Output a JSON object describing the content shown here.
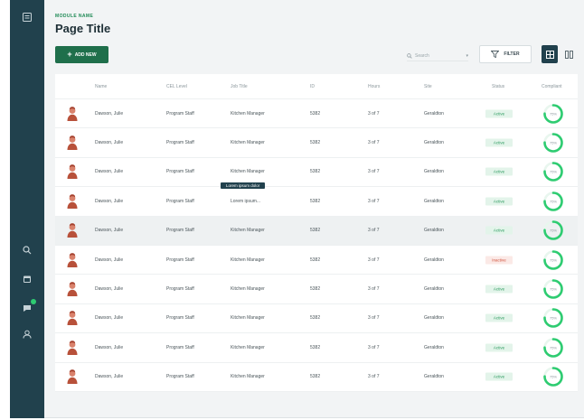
{
  "header": {
    "module_name": "MODULE NAME",
    "page_title": "Page Title"
  },
  "toolbar": {
    "add_label": "ADD NEW",
    "search_placeholder": "Search",
    "filter_label": "FILTER"
  },
  "table": {
    "columns": [
      "Name",
      "CEL Level",
      "Job Title",
      "ID",
      "Hours",
      "Site",
      "Status",
      "Compliant"
    ],
    "rows": [
      {
        "name": "Dawson, Julie",
        "level": "Program Staff",
        "job": "Kitchen Manager",
        "id": "5382",
        "hours": "3 of 7",
        "site": "Geraldton",
        "status": "Active",
        "compliant": "75%"
      },
      {
        "name": "Dawson, Julie",
        "level": "Program Staff",
        "job": "Kitchen Manager",
        "id": "5382",
        "hours": "3 of 7",
        "site": "Geraldton",
        "status": "Active",
        "compliant": "75%"
      },
      {
        "name": "Dawson, Julie",
        "level": "Program Staff",
        "job": "Kitchen Manager",
        "id": "5382",
        "hours": "3 of 7",
        "site": "Geraldton",
        "status": "Active",
        "compliant": "75%"
      },
      {
        "name": "Dawson, Julie",
        "level": "Program Staff",
        "job": "Lorem ipsum...",
        "id": "5382",
        "hours": "3 of 7",
        "site": "Geraldton",
        "status": "Active",
        "compliant": "75%",
        "tooltip": "Lorem ipsum dolor"
      },
      {
        "name": "Dawson, Julie",
        "level": "Program Staff",
        "job": "Kitchen Manager",
        "id": "5382",
        "hours": "3 of 7",
        "site": "Geraldton",
        "status": "Active",
        "compliant": "75%"
      },
      {
        "name": "Dawson, Julie",
        "level": "Program Staff",
        "job": "Kitchen Manager",
        "id": "5382",
        "hours": "3 of 7",
        "site": "Geraldton",
        "status": "Inactive",
        "compliant": "75%"
      },
      {
        "name": "Dawson, Julie",
        "level": "Program Staff",
        "job": "Kitchen Manager",
        "id": "5382",
        "hours": "3 of 7",
        "site": "Geraldton",
        "status": "Active",
        "compliant": "75%"
      },
      {
        "name": "Dawson, Julie",
        "level": "Program Staff",
        "job": "Kitchen Manager",
        "id": "5382",
        "hours": "3 of 7",
        "site": "Geraldton",
        "status": "Active",
        "compliant": "75%"
      },
      {
        "name": "Dawson, Julie",
        "level": "Program Staff",
        "job": "Kitchen Manager",
        "id": "5382",
        "hours": "3 of 7",
        "site": "Geraldton",
        "status": "Active",
        "compliant": "75%"
      },
      {
        "name": "Dawson, Julie",
        "level": "Program Staff",
        "job": "Kitchen Manager",
        "id": "5382",
        "hours": "3 of 7",
        "site": "Geraldton",
        "status": "Active",
        "compliant": "75%"
      }
    ]
  },
  "sidebar": {
    "icons": [
      "menu-icon",
      "search-icon",
      "calendar-icon",
      "chat-icon",
      "user-icon"
    ]
  },
  "colors": {
    "sidebar": "#21414d",
    "accent": "#1f6f4b",
    "active": "#2a9a5d",
    "inactive": "#d1533d",
    "ring": "#2ecc71"
  }
}
